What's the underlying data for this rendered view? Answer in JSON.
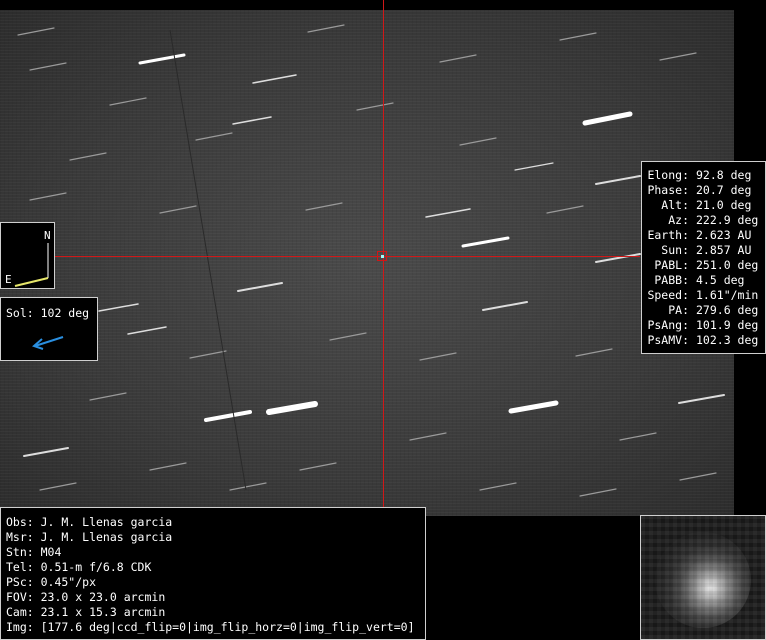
{
  "ephemeris": [
    {
      "key": "Elong:",
      "value": "92.8 deg"
    },
    {
      "key": "Phase:",
      "value": "20.7 deg"
    },
    {
      "key": "Alt:",
      "value": "21.0 deg"
    },
    {
      "key": "Az:",
      "value": "222.9 deg"
    },
    {
      "key": "Earth:",
      "value": "2.623 AU"
    },
    {
      "key": "Sun:",
      "value": "2.857 AU"
    },
    {
      "key": "PABL:",
      "value": "251.0 deg"
    },
    {
      "key": "PABB:",
      "value": "4.5 deg"
    },
    {
      "key": "Speed:",
      "value": "1.61\"/min"
    },
    {
      "key": "PA:",
      "value": "279.6 deg"
    },
    {
      "key": "PsAng:",
      "value": "101.9 deg"
    },
    {
      "key": "PsAMV:",
      "value": "102.3 deg"
    }
  ],
  "observation": [
    "Obs: J. M. Llenas garcia",
    "Msr: J. M. Llenas garcia",
    "Stn: M04",
    "Tel: 0.51-m f/6.8 CDK",
    "PSc: 0.45\"/px",
    "FOV: 23.0 x 23.0 arcmin",
    "Cam: 23.1 x 15.3 arcmin",
    "Img: [177.6 deg|ccd_flip=0|img_flip_horz=0|img_flip_vert=0]"
  ],
  "compass": {
    "north_label": "N",
    "east_label": "E"
  },
  "sol": {
    "label": "Sol: 102 deg"
  },
  "colors": {
    "crosshair": "#d01818",
    "sun_arrow": "#2a8fe0",
    "east_arrow": "#e6e66a"
  }
}
